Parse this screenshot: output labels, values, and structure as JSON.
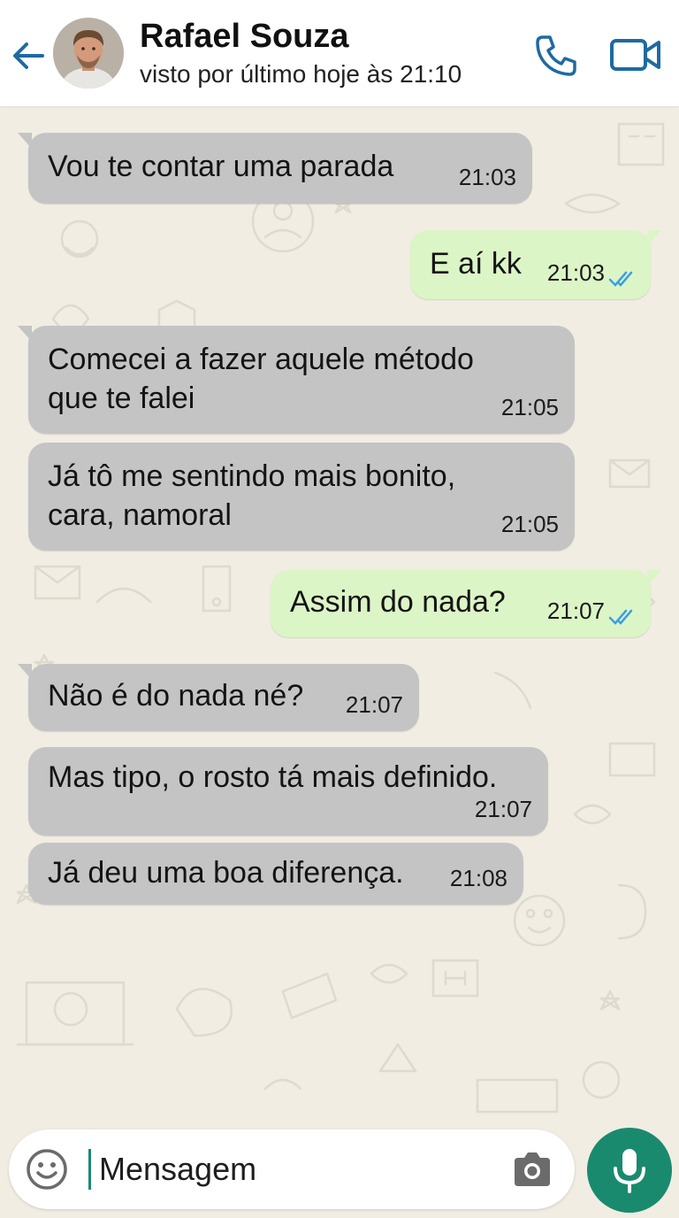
{
  "contact": {
    "name": "Rafael Souza",
    "status": "visto por último hoje às 21:10"
  },
  "messages": [
    {
      "direction": "incoming",
      "lines": [
        "Vou te contar uma parada"
      ],
      "time": "21:03"
    },
    {
      "direction": "outgoing",
      "lines": [
        "E aí kk"
      ],
      "time": "21:03",
      "read": true
    },
    {
      "direction": "incoming",
      "lines": [
        "Comecei a fazer aquele método",
        "que te falei"
      ],
      "time": "21:05"
    },
    {
      "direction": "incoming",
      "lines": [
        "Já tô me sentindo mais bonito,",
        "cara, namoral"
      ],
      "time": "21:05"
    },
    {
      "direction": "outgoing",
      "lines": [
        "Assim do nada?"
      ],
      "time": "21:07",
      "read": true
    },
    {
      "direction": "incoming",
      "lines": [
        "Não é do nada né?"
      ],
      "time": "21:07"
    },
    {
      "direction": "incoming",
      "lines": [
        "Mas tipo, o rosto tá mais definido."
      ],
      "time": "21:07"
    },
    {
      "direction": "incoming",
      "lines": [
        "Já deu uma boa diferença."
      ],
      "time": "21:08"
    }
  ],
  "composer": {
    "placeholder": "Mensagem"
  },
  "icons": {
    "back": "arrow-left-icon",
    "call": "phone-icon",
    "video": "video-camera-icon",
    "emoji": "smiley-icon",
    "camera": "camera-icon",
    "mic": "microphone-icon",
    "read_receipt": "double-check-icon"
  },
  "colors": {
    "accent": "#1a8a6e",
    "incoming_bubble": "#c4c4c4",
    "outgoing_bubble": "#dcf5c6",
    "read_ticks": "#3aa0e8",
    "wallpaper": "#f1ede3",
    "header_icons": "#1f6aa0"
  }
}
